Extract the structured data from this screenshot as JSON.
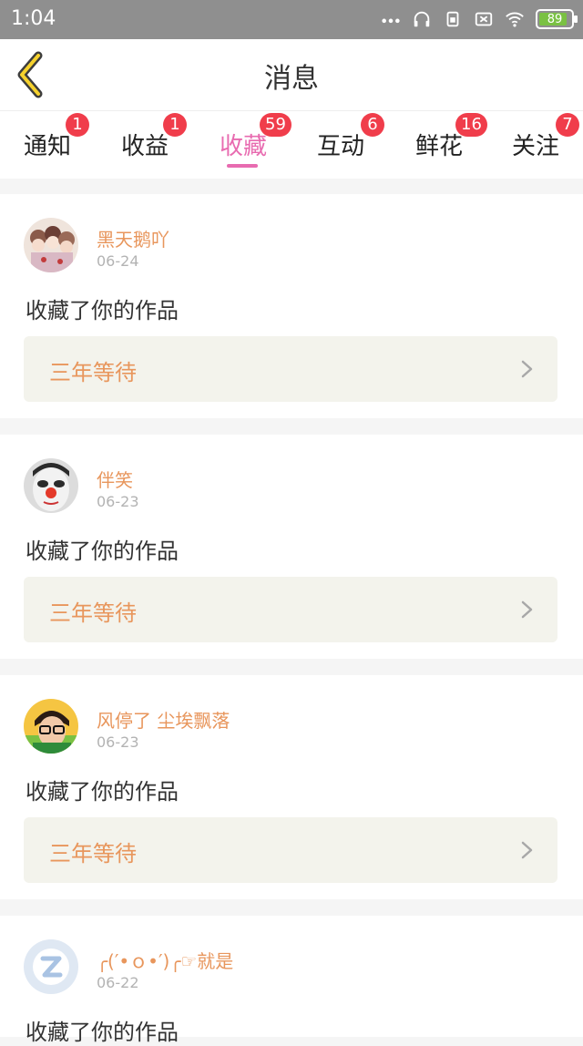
{
  "status": {
    "time": "1:04",
    "battery": "89"
  },
  "header": {
    "title": "消息"
  },
  "tabs": [
    {
      "label": "通知",
      "badge": "1"
    },
    {
      "label": "收益",
      "badge": "1"
    },
    {
      "label": "收藏",
      "badge": "59",
      "active": true
    },
    {
      "label": "互动",
      "badge": "6"
    },
    {
      "label": "鲜花",
      "badge": "16"
    },
    {
      "label": "关注",
      "badge": "7"
    }
  ],
  "messages": [
    {
      "user": "黑天鹅吖",
      "date": "06-24",
      "text": "收藏了你的作品",
      "work": "三年等待",
      "avatar_icon": "anime-characters-avatar"
    },
    {
      "user": "伴笑",
      "date": "06-23",
      "text": "收藏了你的作品",
      "work": "三年等待",
      "avatar_icon": "clown-face-avatar"
    },
    {
      "user": "风停了 尘埃飘落",
      "date": "06-23",
      "text": "收藏了你的作品",
      "work": "三年等待",
      "avatar_icon": "boy-glasses-avatar"
    },
    {
      "user": "╭(′•ｏ•′)╭☞就是",
      "date": "06-22",
      "text": "收藏了你的作品",
      "work": "",
      "avatar_icon": "default-z-avatar"
    }
  ],
  "colors": {
    "accent_pink": "#e86bb0",
    "name_orange": "#e8965c",
    "badge_red": "#f03d4b"
  }
}
